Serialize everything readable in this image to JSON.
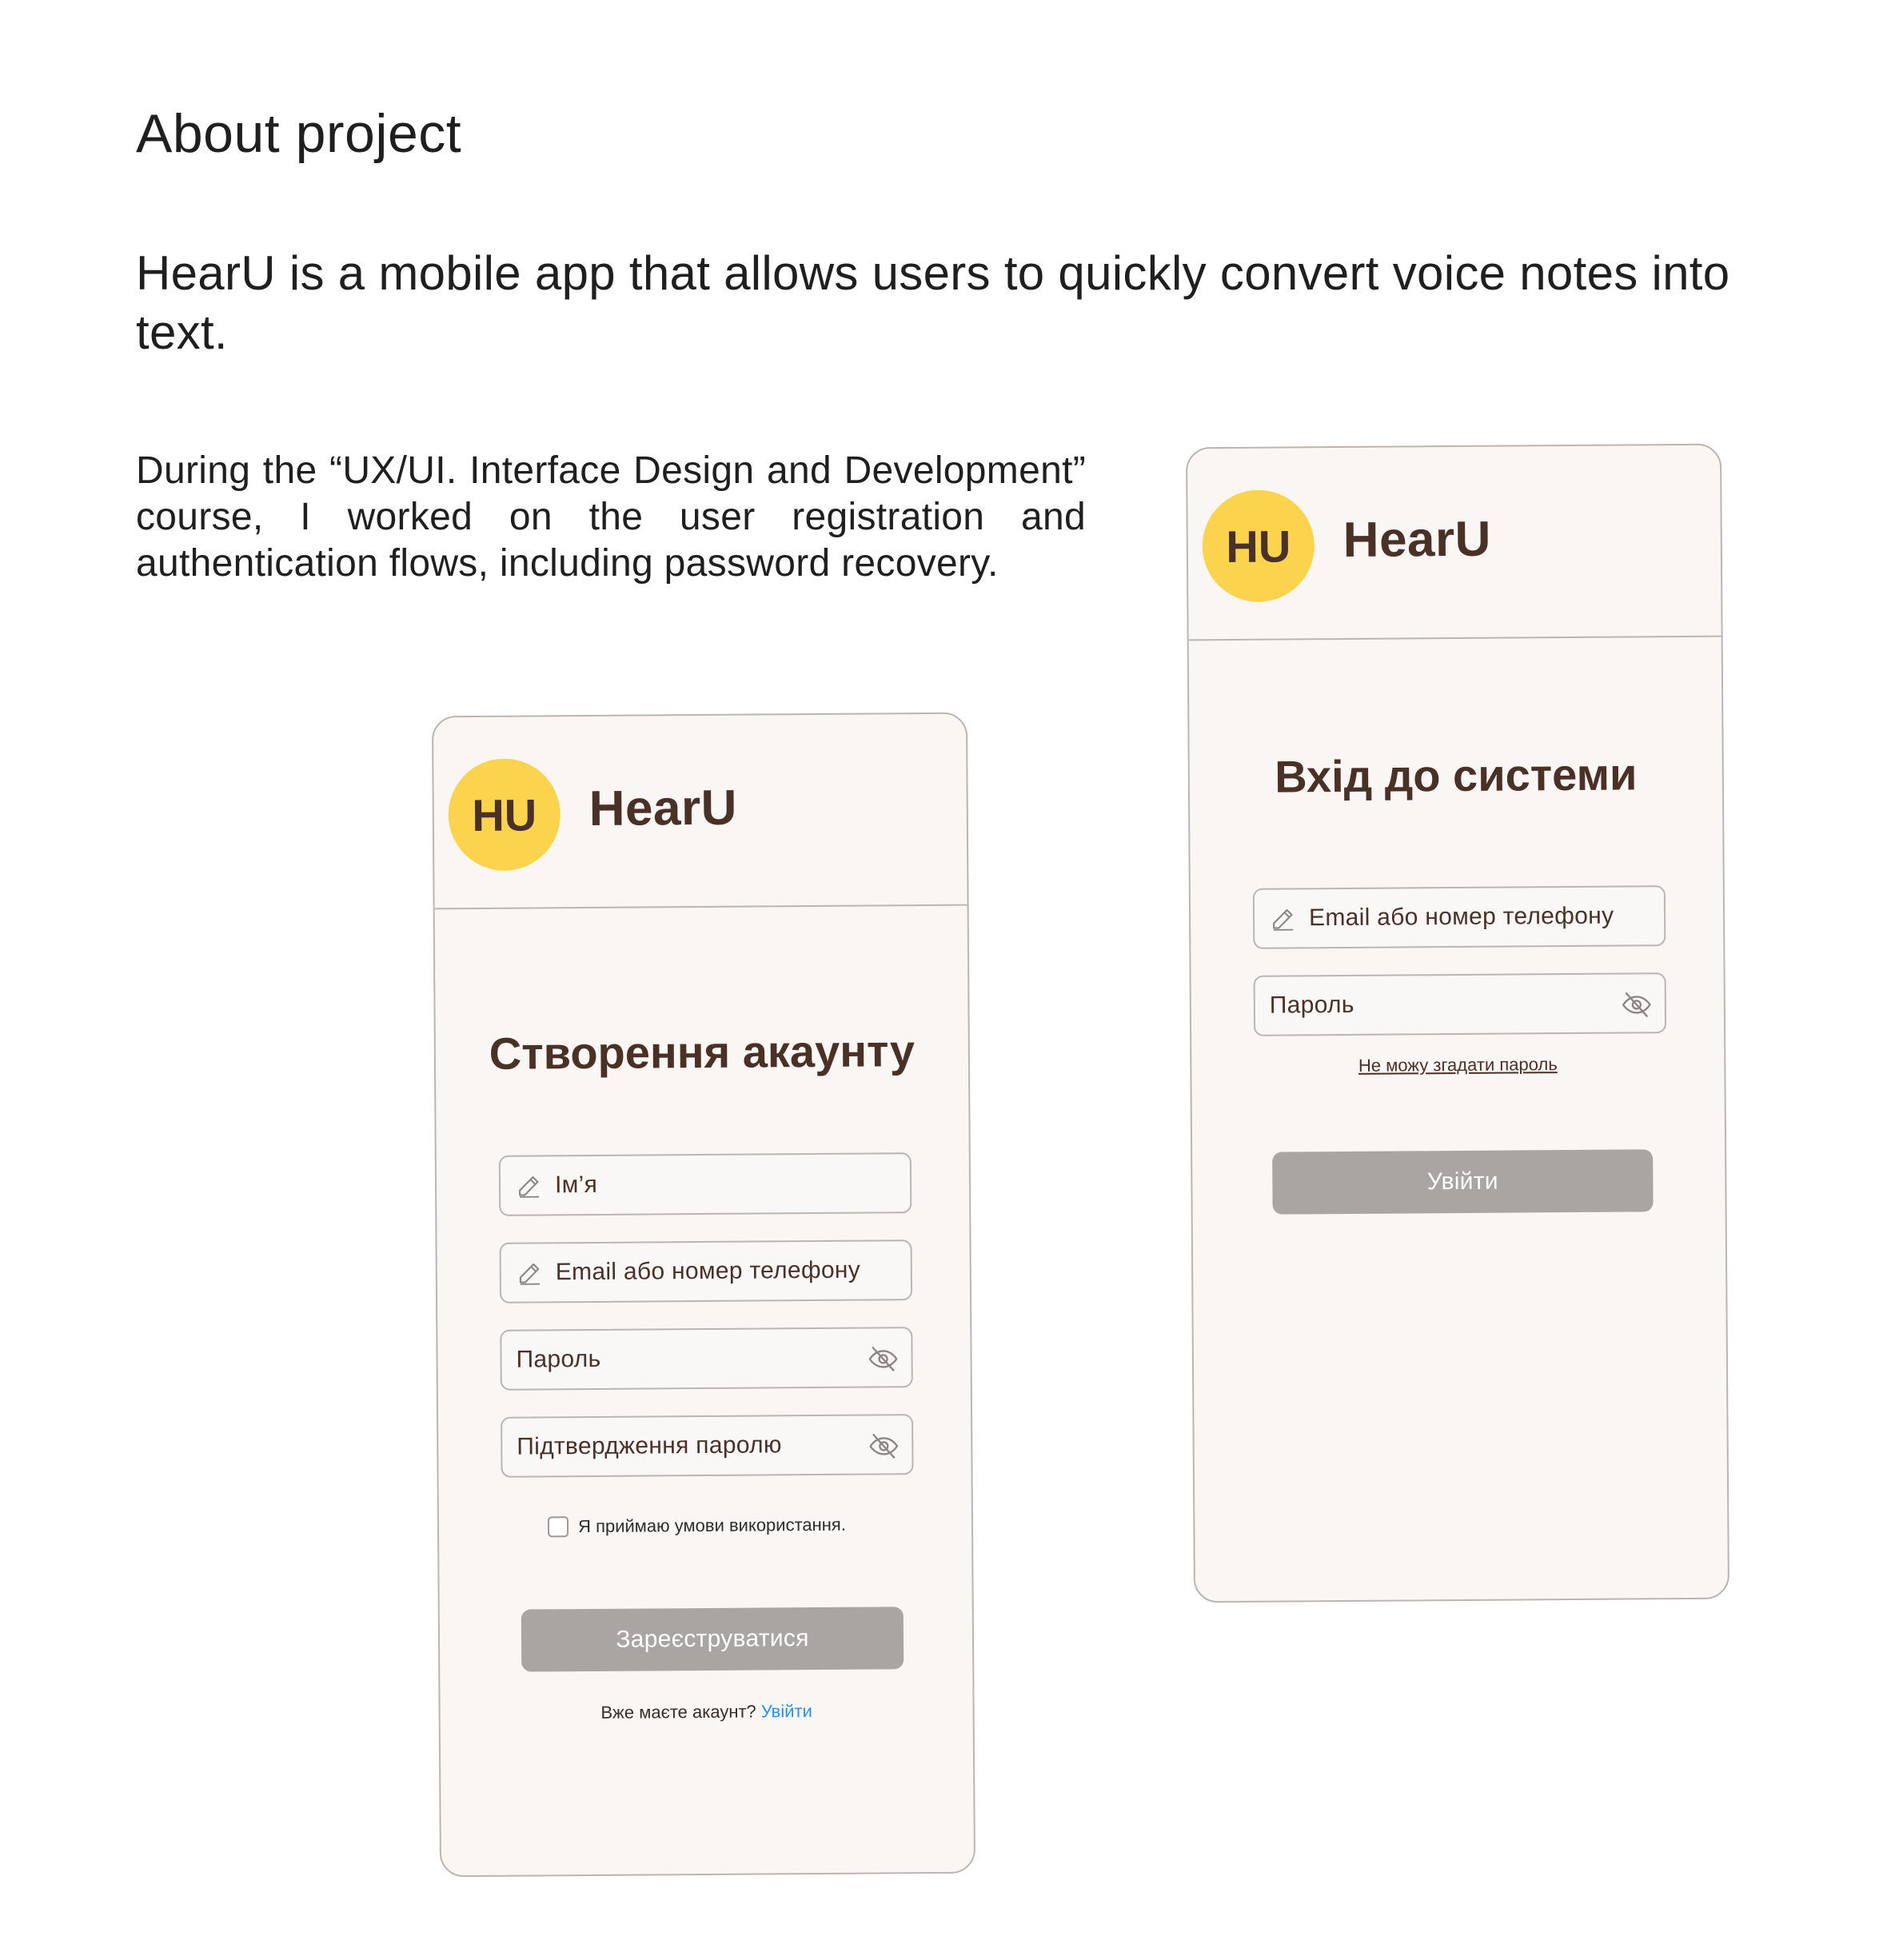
{
  "intro": {
    "title": "About project",
    "lead": "HearU is a mobile app that allows users to quickly convert voice notes into text.",
    "body": "During the “UX/UI. Interface Design and Development” course, I worked on the user registration and authentication flows, including password recovery."
  },
  "colors": {
    "accent": "#fcd34d",
    "brand_text": "#4a3128",
    "button_disabled": "#a9a5a2",
    "link": "#2b8ef0",
    "card_bg": "#f9f6f4"
  },
  "register": {
    "logo_initials": "HU",
    "app_name": "HearU",
    "title": "Створення акаунту",
    "fields": {
      "name": {
        "placeholder": "Ім’я",
        "icon": "pencil-icon"
      },
      "email": {
        "placeholder": "Email або номер телефону",
        "icon": "pencil-icon"
      },
      "password": {
        "placeholder": "Пароль",
        "icon": "eye-off-icon"
      },
      "confirm": {
        "placeholder": "Підтвердження паролю",
        "icon": "eye-off-icon"
      }
    },
    "terms_label": "Я приймаю умови використання.",
    "terms_checked": false,
    "submit_label": "Зареєструватися",
    "have_account_text": "Вже маєте акаунт?",
    "login_link": "Увійти"
  },
  "login": {
    "logo_initials": "HU",
    "app_name": "HearU",
    "title": "Вхід до системи",
    "fields": {
      "email": {
        "placeholder": "Email або номер телефону",
        "icon": "pencil-icon"
      },
      "password": {
        "placeholder": "Пароль",
        "icon": "eye-off-icon"
      }
    },
    "forgot_label": "Не можу згадати пароль",
    "submit_label": "Увійти"
  }
}
